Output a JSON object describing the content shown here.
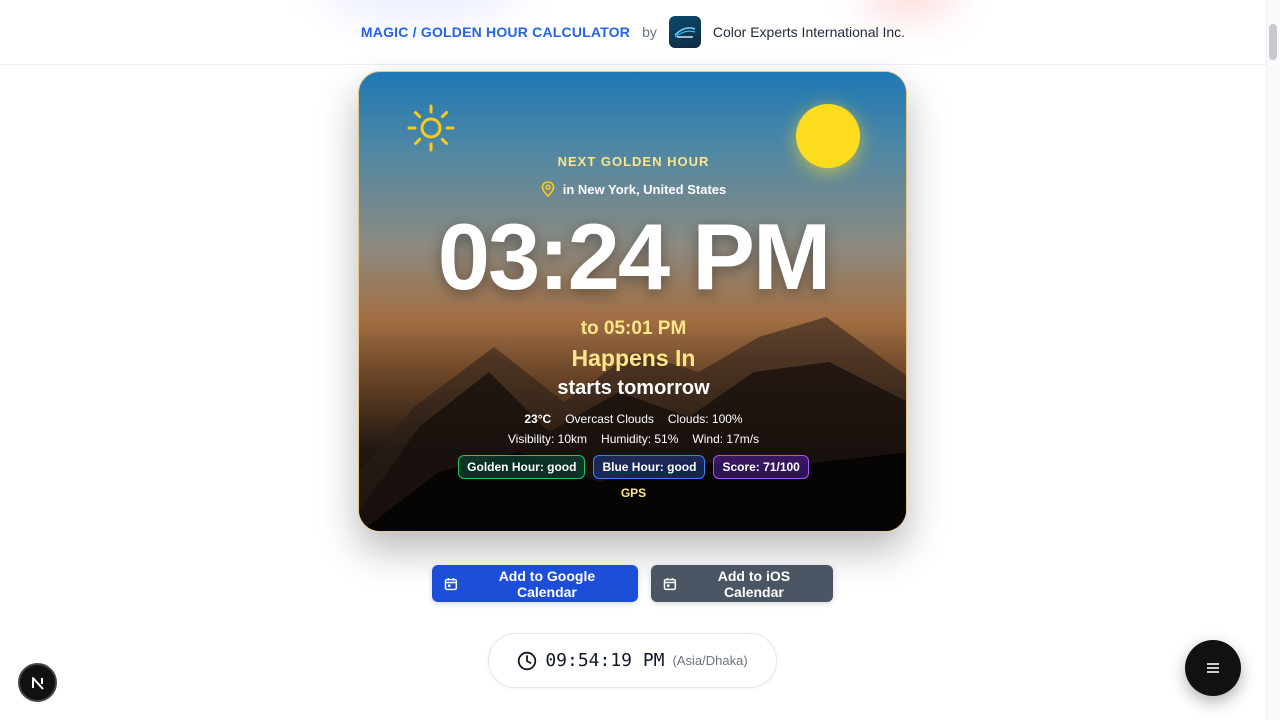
{
  "header": {
    "title": "MAGIC / GOLDEN HOUR CALCULATOR",
    "by": "by",
    "company": "Color Experts International Inc."
  },
  "card": {
    "next_label": "NEXT GOLDEN HOUR",
    "location": "in New York, United States",
    "start_time": "03:24 PM",
    "end_time": "to 05:01 PM",
    "happens_label": "Happens In",
    "starts_label": "starts tomorrow",
    "weather": {
      "temp": "23°C",
      "condition": "Overcast Clouds",
      "clouds": "Clouds: 100%",
      "visibility": "Visibility: 10km",
      "humidity": "Humidity: 51%",
      "wind": "Wind: 17m/s"
    },
    "badges": {
      "golden": "Golden Hour: good",
      "blue": "Blue Hour: good",
      "score": "Score: 71/100"
    },
    "source": "GPS"
  },
  "actions": {
    "google": "Add to Google Calendar",
    "ios": "Add to iOS Calendar"
  },
  "clock": {
    "time": "09:54:19 PM",
    "timezone": "(Asia/Dhaka)"
  },
  "colors": {
    "accent": "#2563eb",
    "google_button": "#1d4ed8",
    "ios_button": "#4b5563",
    "gold": "#fde68a",
    "sun": "#fddc20"
  },
  "icons": {
    "sun": "sun-icon",
    "location": "map-pin-icon",
    "calendar": "calendar-icon",
    "clock": "clock-icon",
    "menu": "menu-icon"
  }
}
